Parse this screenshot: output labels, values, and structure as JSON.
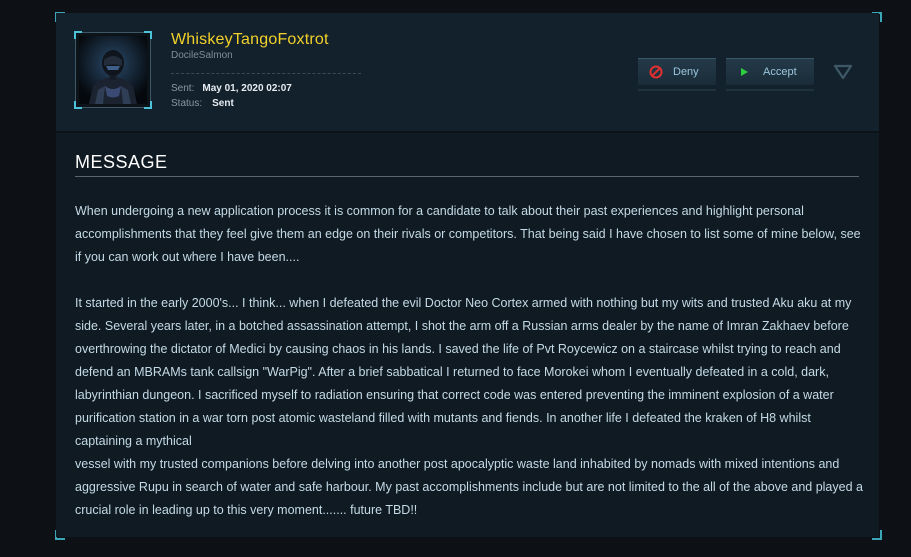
{
  "sender": {
    "username": "WhiskeyTangoFoxtrot",
    "subname": "DocileSalmon",
    "sent_label": "Sent:",
    "sent_value": "May 01, 2020 02:07",
    "status_label": "Status:",
    "status_value": "Sent",
    "avatar_icon": "armored-soldier-avatar"
  },
  "actions": {
    "deny_label": "Deny",
    "accept_label": "Accept",
    "deny_icon": "deny-circle-icon",
    "accept_icon": "play-triangle-icon",
    "dropdown_icon": "chevron-down-triangle-icon",
    "colors": {
      "deny": "#e03030",
      "accept": "#2ecc40",
      "label": "#9bc6de"
    }
  },
  "message": {
    "title": "MESSAGE",
    "paragraph1": "When undergoing a new application process it is common for a candidate to talk about their past experiences and highlight personal accomplishments that they feel give them an edge on their rivals or competitors. That being said I have chosen to list some of mine below, see if you can work out where I have been....",
    "paragraph2": "It started in the early 2000's... I think... when I defeated the evil Doctor Neo Cortex armed with nothing but my wits and trusted Aku aku at my side. Several years later, in a botched assassination attempt, I shot the arm off a Russian arms dealer by the name of Imran Zakhaev before overthrowing the dictator of Medici by causing chaos in his lands. I saved the life of Pvt Roycewicz on a staircase whilst trying to reach and defend an MBRAMs tank callsign \"WarPig\". After a brief sabbatical I returned to face Morokei whom I eventually defeated in a cold, dark, labyrinthian dungeon. I sacrificed myself to radiation ensuring that correct code was entered preventing the imminent explosion of a water purification station in a war torn post atomic wasteland filled with mutants and fiends. In another life I defeated the kraken of H8 whilst captaining a mythical",
    "paragraph3": "vessel with my trusted companions before delving into another post apocalyptic waste land inhabited by nomads with mixed intentions and aggressive Rupu in search of water and safe harbour. My past accomplishments include but are not limited to the all of the above and played a crucial role in leading up to this very moment....... future TBD!!"
  },
  "theme": {
    "accent": "#3aa6b8",
    "username_color": "#f2d12a",
    "text_color": "#c4dae6",
    "panel_bg": "#0f1a22"
  }
}
